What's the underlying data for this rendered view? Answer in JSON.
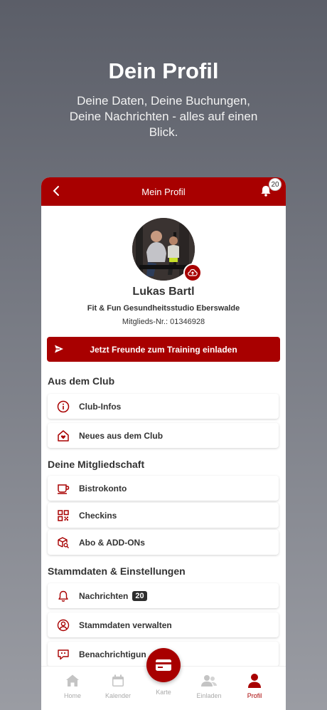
{
  "promo": {
    "title": "Dein Profil",
    "subtitle": "Deine Daten, Deine Buchungen, Deine Nachrichten - alles auf einen Blick."
  },
  "appbar": {
    "title": "Mein Profil",
    "notification_count": "20"
  },
  "profile": {
    "name": "Lukas Bartl",
    "club": "Fit & Fun Gesundheitsstudio Eberswalde",
    "member_number": "Mitglieds-Nr.: 01346928"
  },
  "invite_button": "Jetzt Freunde zum Training einladen",
  "sections": {
    "club": {
      "title": "Aus dem Club",
      "items": [
        {
          "label": "Club-Infos",
          "icon": "info-icon"
        },
        {
          "label": "Neues aus dem Club",
          "icon": "house-heart-icon"
        }
      ]
    },
    "membership": {
      "title": "Deine Mitgliedschaft",
      "items": [
        {
          "label": "Bistrokonto",
          "icon": "cup-icon"
        },
        {
          "label": "Checkins",
          "icon": "qr-code-icon"
        },
        {
          "label": "Abo & ADD-ONs",
          "icon": "box-search-icon"
        }
      ]
    },
    "settings": {
      "title": "Stammdaten & Einstellungen",
      "items": [
        {
          "label": "Nachrichten",
          "icon": "bell-icon",
          "badge": "20"
        },
        {
          "label": "Stammdaten verwalten",
          "icon": "user-circle-icon"
        },
        {
          "label": "Benachrichtigun",
          "icon": "chat-alert-icon"
        }
      ]
    }
  },
  "bottom_nav": {
    "home": "Home",
    "calendar": "Kalender",
    "card": "Karte",
    "invite": "Einladen",
    "profile": "Profil"
  },
  "colors": {
    "brand": "#a80000",
    "inactive": "#aaaaaa"
  }
}
